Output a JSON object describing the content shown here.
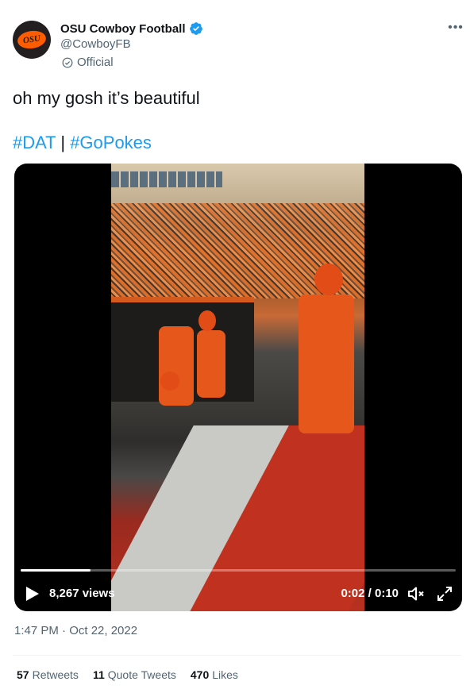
{
  "author": {
    "display_name": "OSU Cowboy Football",
    "handle": "@CowboyFB",
    "label": "Official",
    "avatar_text": "OSU",
    "verified_icon": "verified-badge-icon",
    "more_icon": "more-options-icon"
  },
  "tweet": {
    "text": "oh my gosh it’s beautiful",
    "hashtag_1": "#DAT",
    "separator": "|",
    "hashtag_2": "#GoPokes"
  },
  "video": {
    "views": "8,267 views",
    "timecode": "0:02 / 0:10",
    "progress_fraction": 0.16,
    "play_icon": "play-icon",
    "mute_icon": "muted-speaker-icon",
    "fullscreen_icon": "fullscreen-icon"
  },
  "meta": {
    "timestamp": "1:47 PM · Oct 22, 2022"
  },
  "stats": {
    "retweets_count": "57",
    "retweets_label": "Retweets",
    "quotes_count": "11",
    "quotes_label": "Quote Tweets",
    "likes_count": "470",
    "likes_label": "Likes"
  },
  "colors": {
    "accent": "#1d9bf0",
    "brand_orange": "#fe5c00",
    "text": "#0f1419",
    "secondary_text": "#536471"
  }
}
